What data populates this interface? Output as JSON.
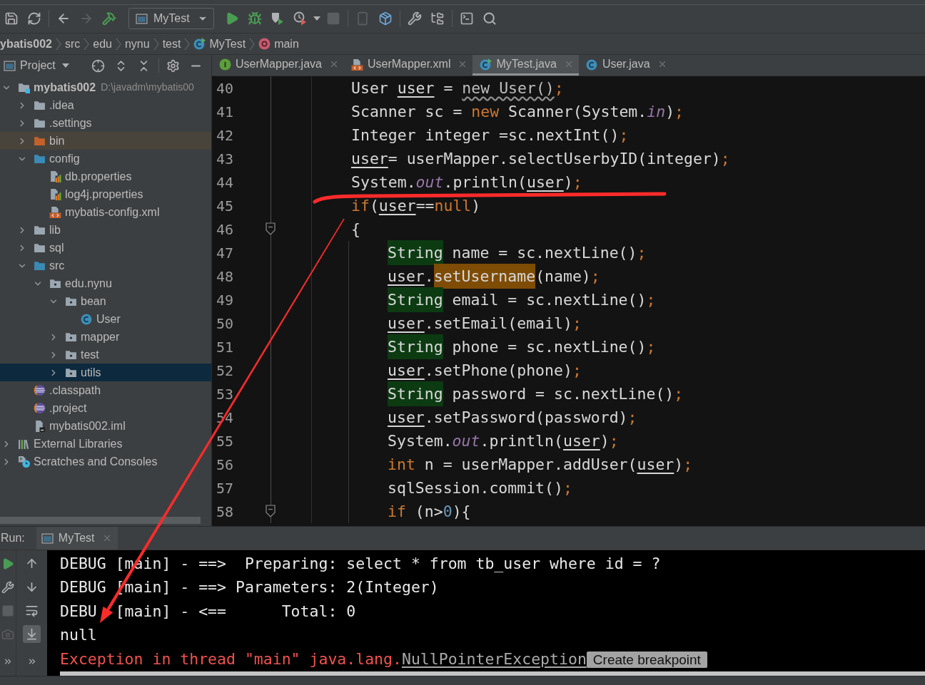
{
  "toolbar": {
    "groups": [
      [
        {
          "kind": "save",
          "disabled": false
        },
        {
          "kind": "sync",
          "disabled": false
        }
      ],
      [
        {
          "kind": "back",
          "disabled": false
        },
        {
          "kind": "forward",
          "disabled": true
        },
        {
          "kind": "build",
          "disabled": false
        },
        {
          "kind": "run_config",
          "label": "MyTest",
          "disabled": false
        },
        {
          "kind": "run",
          "disabled": false
        },
        {
          "kind": "debug",
          "disabled": false
        },
        {
          "kind": "coverage",
          "disabled": false
        },
        {
          "kind": "profile",
          "disabled": false
        },
        {
          "kind": "stop",
          "disabled": true
        }
      ],
      [
        {
          "kind": "device",
          "disabled": true
        },
        {
          "kind": "sdk_download",
          "disabled": false
        }
      ],
      [
        {
          "kind": "settings",
          "disabled": false
        },
        {
          "kind": "project_structure",
          "disabled": false
        }
      ],
      [
        {
          "kind": "run_anything",
          "disabled": false
        },
        {
          "kind": "search",
          "disabled": false
        }
      ]
    ]
  },
  "breadcrumbs": [
    {
      "label": "ybatis002",
      "kind": "project"
    },
    {
      "label": "src",
      "kind": "folder"
    },
    {
      "label": "edu",
      "kind": "folder"
    },
    {
      "label": "nynu",
      "kind": "folder"
    },
    {
      "label": "test",
      "kind": "folder"
    },
    {
      "label": "MyTest",
      "kind": "class"
    },
    {
      "label": "main",
      "kind": "method"
    }
  ],
  "project_panel": {
    "title": "Project",
    "tree": [
      {
        "label": "mybatis002",
        "path": "D:\\javadm\\mybatis00",
        "kind": "project",
        "expanded": true,
        "selected": false,
        "highlighted": false,
        "children": [
          {
            "label": ".idea",
            "kind": "folder",
            "expanded": false,
            "selected": false,
            "highlighted": false
          },
          {
            "label": ".settings",
            "kind": "folder",
            "expanded": false,
            "selected": false,
            "highlighted": false
          },
          {
            "label": "bin",
            "kind": "excluded_folder",
            "expanded": false,
            "selected": false,
            "highlighted": true
          },
          {
            "label": "config",
            "kind": "resource_folder",
            "expanded": true,
            "selected": false,
            "highlighted": false,
            "children": [
              {
                "label": "db.properties",
                "kind": "properties",
                "selected": false,
                "highlighted": false
              },
              {
                "label": "log4j.properties",
                "kind": "properties",
                "selected": false,
                "highlighted": false
              },
              {
                "label": "mybatis-config.xml",
                "kind": "xml",
                "selected": false,
                "highlighted": false
              }
            ]
          },
          {
            "label": "lib",
            "kind": "folder",
            "expanded": false,
            "selected": false,
            "highlighted": false
          },
          {
            "label": "sql",
            "kind": "folder",
            "expanded": false,
            "selected": false,
            "highlighted": false
          },
          {
            "label": "src",
            "kind": "source_folder",
            "expanded": true,
            "selected": false,
            "highlighted": false,
            "children": [
              {
                "label": "edu.nynu",
                "kind": "package",
                "expanded": true,
                "selected": false,
                "highlighted": false,
                "children": [
                  {
                    "label": "bean",
                    "kind": "package",
                    "expanded": true,
                    "selected": false,
                    "highlighted": false,
                    "children": [
                      {
                        "label": "User",
                        "kind": "class",
                        "selected": false,
                        "highlighted": false
                      }
                    ]
                  },
                  {
                    "label": "mapper",
                    "kind": "package",
                    "expanded": false,
                    "selected": false,
                    "highlighted": false
                  },
                  {
                    "label": "test",
                    "kind": "package",
                    "expanded": false,
                    "selected": false,
                    "highlighted": false
                  },
                  {
                    "label": "utils",
                    "kind": "package",
                    "expanded": false,
                    "selected": true,
                    "highlighted": false
                  }
                ]
              }
            ]
          },
          {
            "label": ".classpath",
            "kind": "eclipse_file",
            "selected": false,
            "highlighted": false
          },
          {
            "label": ".project",
            "kind": "eclipse_file",
            "selected": false,
            "highlighted": false
          },
          {
            "label": "mybatis002.iml",
            "kind": "module_file",
            "selected": false,
            "highlighted": false
          }
        ]
      },
      {
        "label": "External Libraries",
        "kind": "libraries",
        "expanded": false,
        "selected": false,
        "highlighted": false
      },
      {
        "label": "Scratches and Consoles",
        "kind": "scratches",
        "expanded": false,
        "selected": false,
        "highlighted": false
      }
    ]
  },
  "tabs": [
    {
      "label": "UserMapper.java",
      "kind": "interface",
      "selected": false
    },
    {
      "label": "UserMapper.xml",
      "kind": "xml",
      "selected": false
    },
    {
      "label": "MyTest.java",
      "kind": "runnable_class",
      "selected": true
    },
    {
      "label": "User.java",
      "kind": "class",
      "selected": false
    }
  ],
  "editor": {
    "lines": [
      {
        "number": "40",
        "foldable": false,
        "tokens": [
          {
            "text": "User ",
            "kind": "plain"
          },
          {
            "text": "user",
            "kind": "var"
          },
          {
            "text": " = ",
            "kind": "plain"
          },
          {
            "text": "new User()",
            "kind": "warn"
          },
          {
            "text": ";",
            "kind": "punct"
          }
        ]
      },
      {
        "number": "41",
        "foldable": false,
        "tokens": [
          {
            "text": "Scanner sc = ",
            "kind": "plain"
          },
          {
            "text": "new",
            "kind": "keyword"
          },
          {
            "text": " Scanner(System.",
            "kind": "plain"
          },
          {
            "text": "in",
            "kind": "field"
          },
          {
            "text": ")",
            "kind": "plain"
          },
          {
            "text": ";",
            "kind": "punct"
          }
        ]
      },
      {
        "number": "42",
        "foldable": false,
        "tokens": [
          {
            "text": "Integer integer =sc.nextInt()",
            "kind": "plain"
          },
          {
            "text": ";",
            "kind": "punct"
          }
        ]
      },
      {
        "number": "43",
        "foldable": false,
        "tokens": [
          {
            "text": "user",
            "kind": "var"
          },
          {
            "text": "= userMapper.selectUserbyID(integer)",
            "kind": "plain"
          },
          {
            "text": ";",
            "kind": "punct"
          }
        ]
      },
      {
        "number": "44",
        "foldable": false,
        "tokens": [
          {
            "text": "System.",
            "kind": "plain"
          },
          {
            "text": "out",
            "kind": "field"
          },
          {
            "text": ".println(",
            "kind": "plain"
          },
          {
            "text": "user",
            "kind": "var"
          },
          {
            "text": ")",
            "kind": "plain"
          },
          {
            "text": ";",
            "kind": "punct"
          }
        ]
      },
      {
        "number": "45",
        "foldable": false,
        "tokens": [
          {
            "text": "if",
            "kind": "keyword"
          },
          {
            "text": "(",
            "kind": "plain"
          },
          {
            "text": "user",
            "kind": "var"
          },
          {
            "text": "==",
            "kind": "plain"
          },
          {
            "text": "null",
            "kind": "keyword"
          },
          {
            "text": ")",
            "kind": "plain"
          }
        ]
      },
      {
        "number": "46",
        "foldable": true,
        "tokens": [
          {
            "text": "{",
            "kind": "plain"
          }
        ],
        "children": [
          {
            "number": "47",
            "foldable": false,
            "tokens": [
              {
                "text": "String",
                "kind": "type_highlight"
              },
              {
                "text": " name = sc.nextLine()",
                "kind": "plain"
              },
              {
                "text": ";",
                "kind": "punct"
              }
            ]
          },
          {
            "number": "48",
            "foldable": false,
            "tokens": [
              {
                "text": "user",
                "kind": "var"
              },
              {
                "text": ".",
                "kind": "plain"
              },
              {
                "text": "setUsername",
                "kind": "call_highlight"
              },
              {
                "text": "(name)",
                "kind": "plain"
              },
              {
                "text": ";",
                "kind": "punct"
              }
            ]
          },
          {
            "number": "49",
            "foldable": false,
            "tokens": [
              {
                "text": "String",
                "kind": "type_highlight"
              },
              {
                "text": " email = sc.nextLine()",
                "kind": "plain"
              },
              {
                "text": ";",
                "kind": "punct"
              }
            ]
          },
          {
            "number": "50",
            "foldable": false,
            "tokens": [
              {
                "text": "user",
                "kind": "var"
              },
              {
                "text": ".setEmail(email)",
                "kind": "plain"
              },
              {
                "text": ";",
                "kind": "punct"
              }
            ]
          },
          {
            "number": "51",
            "foldable": false,
            "tokens": [
              {
                "text": "String",
                "kind": "type_highlight"
              },
              {
                "text": " phone = sc.nextLine()",
                "kind": "plain"
              },
              {
                "text": ";",
                "kind": "punct"
              }
            ]
          },
          {
            "number": "52",
            "foldable": false,
            "tokens": [
              {
                "text": "user",
                "kind": "var"
              },
              {
                "text": ".setPhone(phone)",
                "kind": "plain"
              },
              {
                "text": ";",
                "kind": "punct"
              }
            ]
          },
          {
            "number": "53",
            "foldable": false,
            "tokens": [
              {
                "text": "String",
                "kind": "type_highlight"
              },
              {
                "text": " password = sc.nextLine()",
                "kind": "plain"
              },
              {
                "text": ";",
                "kind": "punct"
              }
            ]
          },
          {
            "number": "54",
            "foldable": false,
            "tokens": [
              {
                "text": "user",
                "kind": "var"
              },
              {
                "text": ".setPassword(password)",
                "kind": "plain"
              },
              {
                "text": ";",
                "kind": "punct"
              }
            ]
          },
          {
            "number": "55",
            "foldable": false,
            "tokens": [
              {
                "text": "System.",
                "kind": "plain"
              },
              {
                "text": "out",
                "kind": "field"
              },
              {
                "text": ".println(",
                "kind": "plain"
              },
              {
                "text": "user",
                "kind": "var"
              },
              {
                "text": ")",
                "kind": "plain"
              },
              {
                "text": ";",
                "kind": "punct"
              }
            ]
          },
          {
            "number": "56",
            "foldable": false,
            "tokens": [
              {
                "text": "int",
                "kind": "keyword"
              },
              {
                "text": " n = userMapper.addUser(",
                "kind": "plain"
              },
              {
                "text": "user",
                "kind": "var"
              },
              {
                "text": ")",
                "kind": "plain"
              },
              {
                "text": ";",
                "kind": "punct"
              }
            ]
          },
          {
            "number": "57",
            "foldable": false,
            "tokens": [
              {
                "text": "sqlSession.commit()",
                "kind": "plain"
              },
              {
                "text": ";",
                "kind": "punct"
              }
            ]
          },
          {
            "number": "58",
            "foldable": true,
            "tokens": [
              {
                "text": "if",
                "kind": "keyword"
              },
              {
                "text": " (n>",
                "kind": "plain"
              },
              {
                "text": "0",
                "kind": "number"
              },
              {
                "text": "){",
                "kind": "plain"
              }
            ]
          }
        ]
      }
    ]
  },
  "run_panel": {
    "label": "Run:",
    "tab": {
      "label": "MyTest"
    },
    "tools_left": [
      {
        "kind": "rerun",
        "disabled": false
      },
      {
        "kind": "settings",
        "disabled": false
      },
      {
        "kind": "stop",
        "disabled": true
      },
      {
        "kind": "screenshot",
        "disabled": true
      },
      {
        "kind": "more",
        "disabled": false
      }
    ],
    "tools_right": [
      {
        "kind": "scroll_up",
        "selected": false
      },
      {
        "kind": "scroll_down",
        "selected": false
      },
      {
        "kind": "soft_wrap",
        "selected": false
      },
      {
        "kind": "scroll_to_end",
        "selected": true
      },
      {
        "kind": "more",
        "selected": false
      }
    ],
    "console": [
      {
        "kind": "output",
        "text": "DEBUG [main] - ==>  Preparing: select * from tb_user where id = ?"
      },
      {
        "kind": "output",
        "text": "DEBUG [main] - ==> Parameters: 2(Integer)"
      },
      {
        "kind": "partly_covered",
        "parts": [
          "DEBU",
          "[main] - <==      Total: 0"
        ]
      },
      {
        "kind": "output",
        "text": "null"
      },
      {
        "kind": "error",
        "text": "Exception in thread \"main\" java.lang.",
        "link": "NullPointerException",
        "action": "Create breakpoint"
      }
    ]
  },
  "annotations": [
    {
      "kind": "underline"
    },
    {
      "kind": "arrow"
    }
  ]
}
